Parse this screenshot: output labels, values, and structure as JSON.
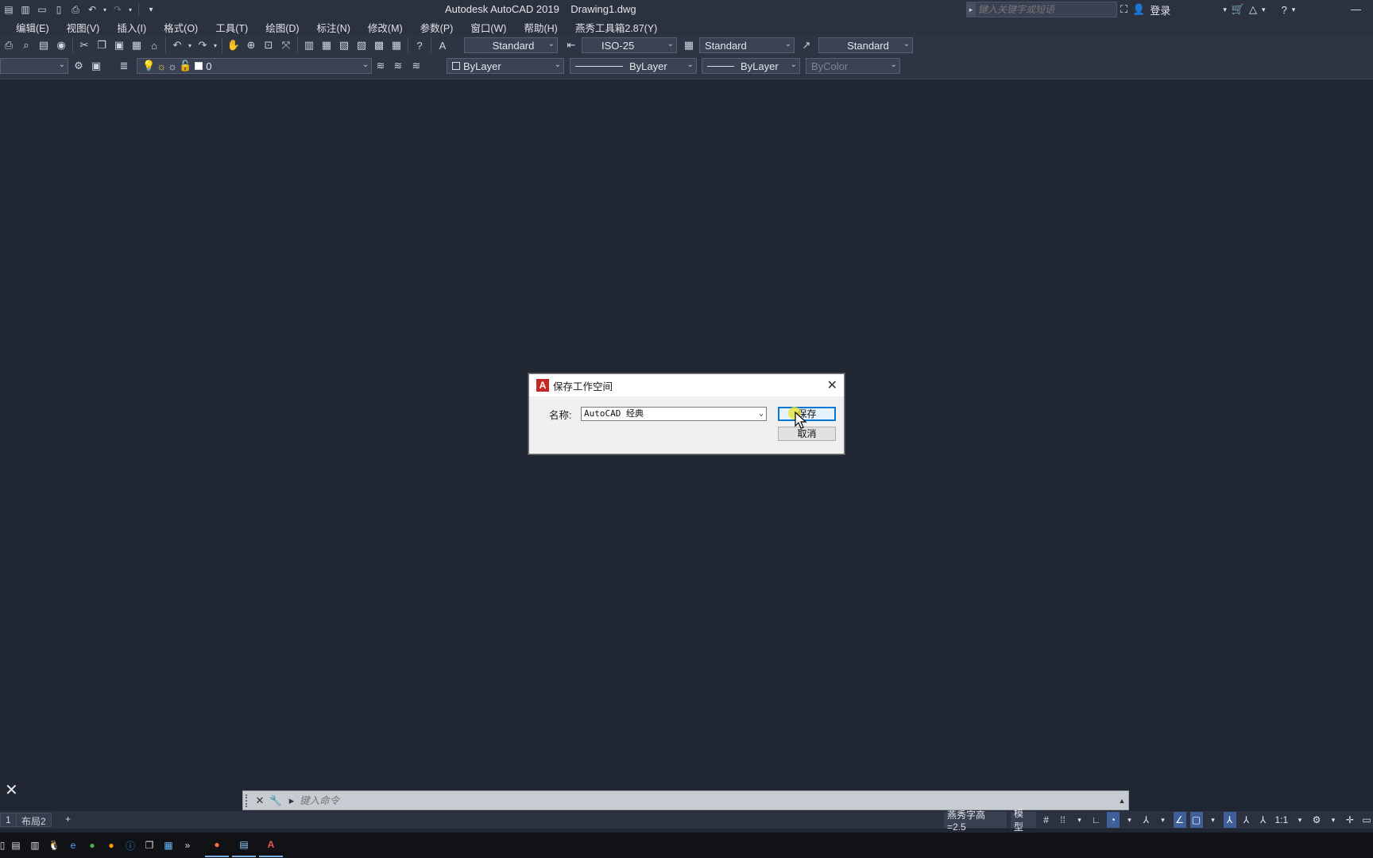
{
  "app": {
    "title": "Autodesk AutoCAD 2019    Drawing1.dwg"
  },
  "title_bar": {
    "search_placeholder": "键入关键字或短语",
    "login_label": "登录"
  },
  "menubar": {
    "items": [
      "编辑(E)",
      "视图(V)",
      "插入(I)",
      "格式(O)",
      "工具(T)",
      "绘图(D)",
      "标注(N)",
      "修改(M)",
      "参数(P)",
      "窗口(W)",
      "帮助(H)",
      "燕秀工具箱2.87(Y)"
    ]
  },
  "styles_toolbar": {
    "text_style": "Standard",
    "dim_style": "ISO-25",
    "table_style": "Standard",
    "mleader_style": "Standard"
  },
  "layers_toolbar": {
    "current_layer": "0"
  },
  "properties_toolbar": {
    "color": "ByLayer",
    "linetype": "ByLayer",
    "lineweight": "ByLayer",
    "plot_style": "ByColor"
  },
  "dialog": {
    "title": "保存工作空间",
    "name_label": "名称:",
    "name_value": "AutoCAD 经典",
    "save_button": "保存",
    "cancel_button": "取消"
  },
  "command_line": {
    "placeholder": "键入命令"
  },
  "layout_tabs": {
    "tab_1_partial": "1",
    "tab_2": "布局2",
    "add": "+"
  },
  "statusbar": {
    "text_height": "燕秀字高=2.5",
    "model": "模型",
    "scale": "1:1"
  },
  "colors": {
    "canvas_bg": "#212633",
    "ui_bg": "#2b313f",
    "accent": "#0078d7",
    "autocad_red": "#c62828"
  }
}
